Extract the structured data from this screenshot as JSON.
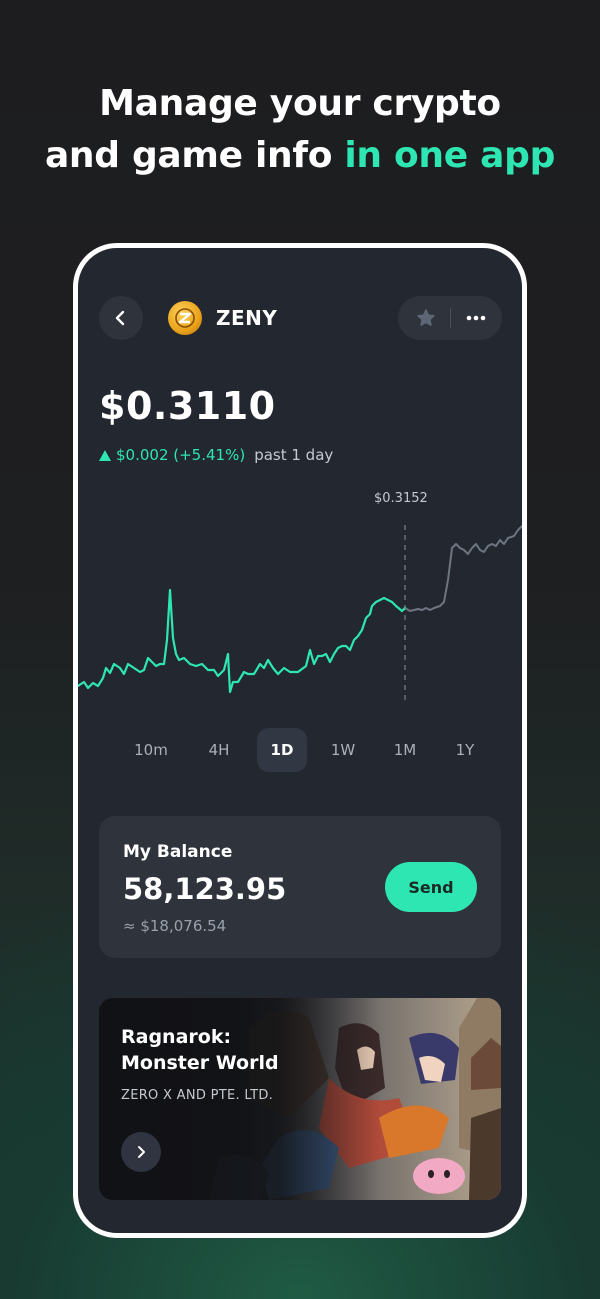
{
  "headline": {
    "line1": "Manage your crypto",
    "line2_plain": "and game info",
    "line2_accent": "in one app"
  },
  "header": {
    "coin_name": "ZENY",
    "icons": [
      "back-arrow-icon",
      "star-icon",
      "more-icon"
    ]
  },
  "price": {
    "value": "$0.3110",
    "change": "$0.002 (+5.41%)",
    "period": "past 1 day"
  },
  "chart": {
    "tooltip_price": "$0.3152"
  },
  "timeframes": [
    {
      "label": "10m",
      "active": false
    },
    {
      "label": "4H",
      "active": false
    },
    {
      "label": "1D",
      "active": true
    },
    {
      "label": "1W",
      "active": false
    },
    {
      "label": "1M",
      "active": false
    },
    {
      "label": "1Y",
      "active": false
    }
  ],
  "balance": {
    "label": "My Balance",
    "amount": "58,123.95",
    "usd": "≈ $18,076.54",
    "send_label": "Send"
  },
  "game": {
    "title": "Ragnarok: Monster World",
    "publisher": "ZERO X AND PTE. LTD.",
    "icon": "chevron-right-icon"
  },
  "colors": {
    "accent": "#2ee6b2",
    "card": "#2e333c",
    "screen_bg": "#23272f"
  }
}
